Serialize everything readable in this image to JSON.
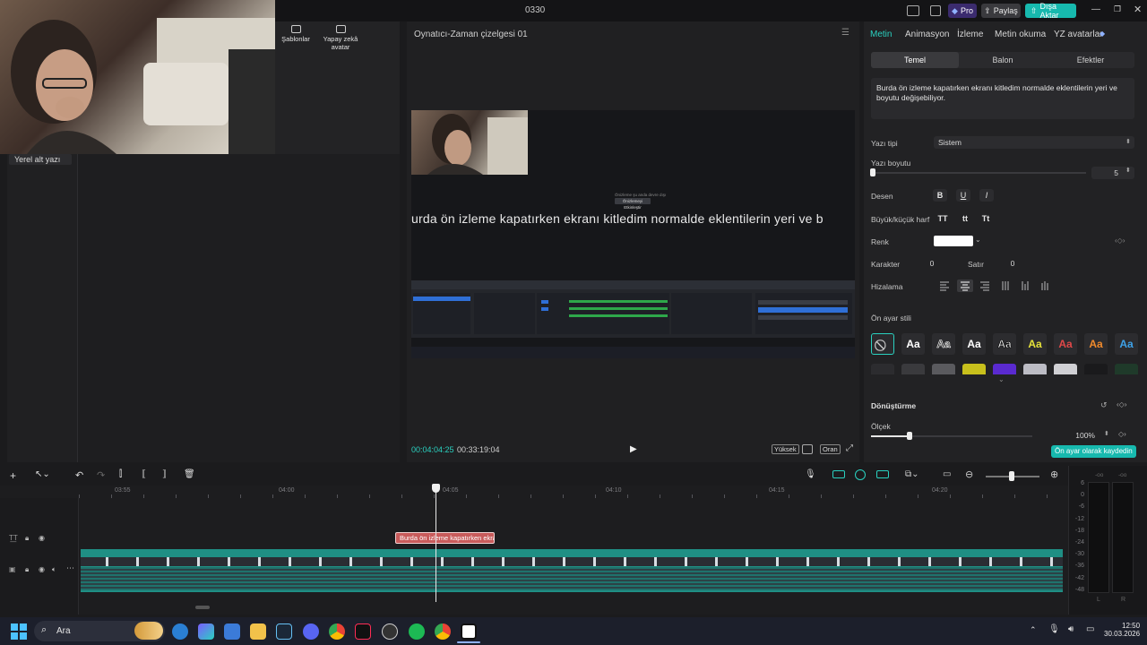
{
  "window": {
    "title": "0330",
    "pro_label": "Pro",
    "share_label": "Paylaş",
    "export_label": "Dışa Aktar"
  },
  "media_panel": {
    "templates_label": "Şablonlar",
    "ai_avatar_label": "Yapay zekâ avatar",
    "local_caption_label": "Yerel alt yazı"
  },
  "player": {
    "title": "Oynatıcı-Zaman çizelgesi 01",
    "subtitle_text": "urda ön izleme kapatırken ekranı kitledim normalde eklentilerin yeri ve b",
    "current_time": "00:04:04:25",
    "total_time": "00:33:19:04",
    "quality_label": "Yüksek",
    "ratio_label": "Oran",
    "overlay_btn": "Önizlemeyi Etkinleştir"
  },
  "props": {
    "tabs": [
      "Metin",
      "Animasyon",
      "İzleme",
      "Metin okuma",
      "YZ avatarlar"
    ],
    "subtabs": [
      "Temel",
      "Balon",
      "Efektler"
    ],
    "text_content": "Burda ön izleme kapatırken ekranı kitledim normalde eklentilerin yeri ve boyutu değişebiliyor.",
    "font_label": "Yazı tipi",
    "font_value": "Sistem",
    "size_label": "Yazı boyutu",
    "size_value": "5",
    "pattern_label": "Desen",
    "case_label": "Büyük/küçük harf",
    "case_opts": [
      "TT",
      "tt",
      "Tt"
    ],
    "color_label": "Renk",
    "color_value": "#ffffff",
    "char_label": "Karakter",
    "char_value": "0",
    "line_label": "Satır",
    "line_value": "0",
    "align_label": "Hizalama",
    "preset_label": "Ön ayar stili",
    "preset_glyph": "Aa",
    "transform_label": "Dönüştürme",
    "scale_label": "Ölçek",
    "scale_value": "100%",
    "scale_fraction": 0.24,
    "save_preset_label": "Ön ayar olarak kaydedin"
  },
  "timeline": {
    "ticks": [
      "03:55",
      "04:00",
      "04:05",
      "04:10",
      "04:15",
      "04:20"
    ],
    "caption_clip": "Burda ön izleme kapatırken ekranı",
    "meter_labels": [
      "6",
      "0",
      "-6",
      "-12",
      "-18",
      "-24",
      "-30",
      "-36",
      "-42",
      "-48"
    ],
    "meter_top": [
      "-oo",
      "-oo"
    ],
    "meter_bottom": [
      "L",
      "R"
    ]
  },
  "taskbar": {
    "search_placeholder": "Ara",
    "time": "12:50",
    "date": "30.03.2026"
  },
  "colors": {
    "accent": "#2ad1c0",
    "caption_clip": "#c85b5b",
    "video_track": "#1f8f84",
    "pro_badge": "#3b2b6e"
  }
}
